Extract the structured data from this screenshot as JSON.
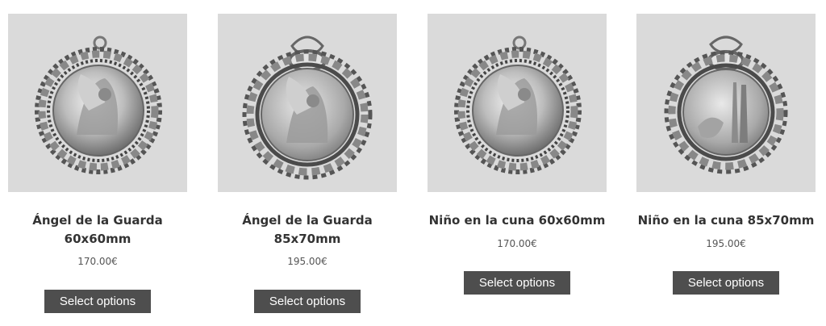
{
  "products": [
    {
      "title": "Ángel de la Guarda 60x60mm",
      "price": "170.00€",
      "button_label": "Select options",
      "image_desc": "medal-angel-round"
    },
    {
      "title": "Ángel de la Guarda 85x70mm",
      "price": "195.00€",
      "button_label": "Select options",
      "image_desc": "medal-angel-cartouche"
    },
    {
      "title": "Niño en la cuna 60x60mm",
      "price": "170.00€",
      "button_label": "Select options",
      "image_desc": "medal-angel-round"
    },
    {
      "title": "Niño en la cuna 85x70mm",
      "price": "195.00€",
      "button_label": "Select options",
      "image_desc": "medal-child-cartouche"
    }
  ],
  "colors": {
    "image_bg": "#dadada",
    "button_bg": "#4e4e4e",
    "title_text": "#333333",
    "price_text": "#555555"
  }
}
